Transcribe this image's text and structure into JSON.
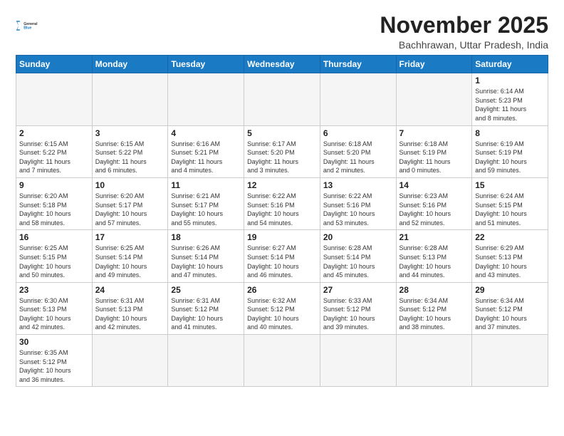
{
  "header": {
    "logo_text_normal": "General",
    "logo_text_blue": "Blue",
    "month_title": "November 2025",
    "location": "Bachhrawan, Uttar Pradesh, India"
  },
  "weekdays": [
    "Sunday",
    "Monday",
    "Tuesday",
    "Wednesday",
    "Thursday",
    "Friday",
    "Saturday"
  ],
  "days": [
    {
      "num": "",
      "info": "",
      "empty": true
    },
    {
      "num": "",
      "info": "",
      "empty": true
    },
    {
      "num": "",
      "info": "",
      "empty": true
    },
    {
      "num": "",
      "info": "",
      "empty": true
    },
    {
      "num": "",
      "info": "",
      "empty": true
    },
    {
      "num": "",
      "info": "",
      "empty": true
    },
    {
      "num": "1",
      "info": "Sunrise: 6:14 AM\nSunset: 5:23 PM\nDaylight: 11 hours\nand 8 minutes.",
      "empty": false
    },
    {
      "num": "2",
      "info": "Sunrise: 6:15 AM\nSunset: 5:22 PM\nDaylight: 11 hours\nand 7 minutes.",
      "empty": false
    },
    {
      "num": "3",
      "info": "Sunrise: 6:15 AM\nSunset: 5:22 PM\nDaylight: 11 hours\nand 6 minutes.",
      "empty": false
    },
    {
      "num": "4",
      "info": "Sunrise: 6:16 AM\nSunset: 5:21 PM\nDaylight: 11 hours\nand 4 minutes.",
      "empty": false
    },
    {
      "num": "5",
      "info": "Sunrise: 6:17 AM\nSunset: 5:20 PM\nDaylight: 11 hours\nand 3 minutes.",
      "empty": false
    },
    {
      "num": "6",
      "info": "Sunrise: 6:18 AM\nSunset: 5:20 PM\nDaylight: 11 hours\nand 2 minutes.",
      "empty": false
    },
    {
      "num": "7",
      "info": "Sunrise: 6:18 AM\nSunset: 5:19 PM\nDaylight: 11 hours\nand 0 minutes.",
      "empty": false
    },
    {
      "num": "8",
      "info": "Sunrise: 6:19 AM\nSunset: 5:19 PM\nDaylight: 10 hours\nand 59 minutes.",
      "empty": false
    },
    {
      "num": "9",
      "info": "Sunrise: 6:20 AM\nSunset: 5:18 PM\nDaylight: 10 hours\nand 58 minutes.",
      "empty": false
    },
    {
      "num": "10",
      "info": "Sunrise: 6:20 AM\nSunset: 5:17 PM\nDaylight: 10 hours\nand 57 minutes.",
      "empty": false
    },
    {
      "num": "11",
      "info": "Sunrise: 6:21 AM\nSunset: 5:17 PM\nDaylight: 10 hours\nand 55 minutes.",
      "empty": false
    },
    {
      "num": "12",
      "info": "Sunrise: 6:22 AM\nSunset: 5:16 PM\nDaylight: 10 hours\nand 54 minutes.",
      "empty": false
    },
    {
      "num": "13",
      "info": "Sunrise: 6:22 AM\nSunset: 5:16 PM\nDaylight: 10 hours\nand 53 minutes.",
      "empty": false
    },
    {
      "num": "14",
      "info": "Sunrise: 6:23 AM\nSunset: 5:16 PM\nDaylight: 10 hours\nand 52 minutes.",
      "empty": false
    },
    {
      "num": "15",
      "info": "Sunrise: 6:24 AM\nSunset: 5:15 PM\nDaylight: 10 hours\nand 51 minutes.",
      "empty": false
    },
    {
      "num": "16",
      "info": "Sunrise: 6:25 AM\nSunset: 5:15 PM\nDaylight: 10 hours\nand 50 minutes.",
      "empty": false
    },
    {
      "num": "17",
      "info": "Sunrise: 6:25 AM\nSunset: 5:14 PM\nDaylight: 10 hours\nand 49 minutes.",
      "empty": false
    },
    {
      "num": "18",
      "info": "Sunrise: 6:26 AM\nSunset: 5:14 PM\nDaylight: 10 hours\nand 47 minutes.",
      "empty": false
    },
    {
      "num": "19",
      "info": "Sunrise: 6:27 AM\nSunset: 5:14 PM\nDaylight: 10 hours\nand 46 minutes.",
      "empty": false
    },
    {
      "num": "20",
      "info": "Sunrise: 6:28 AM\nSunset: 5:14 PM\nDaylight: 10 hours\nand 45 minutes.",
      "empty": false
    },
    {
      "num": "21",
      "info": "Sunrise: 6:28 AM\nSunset: 5:13 PM\nDaylight: 10 hours\nand 44 minutes.",
      "empty": false
    },
    {
      "num": "22",
      "info": "Sunrise: 6:29 AM\nSunset: 5:13 PM\nDaylight: 10 hours\nand 43 minutes.",
      "empty": false
    },
    {
      "num": "23",
      "info": "Sunrise: 6:30 AM\nSunset: 5:13 PM\nDaylight: 10 hours\nand 42 minutes.",
      "empty": false
    },
    {
      "num": "24",
      "info": "Sunrise: 6:31 AM\nSunset: 5:13 PM\nDaylight: 10 hours\nand 42 minutes.",
      "empty": false
    },
    {
      "num": "25",
      "info": "Sunrise: 6:31 AM\nSunset: 5:12 PM\nDaylight: 10 hours\nand 41 minutes.",
      "empty": false
    },
    {
      "num": "26",
      "info": "Sunrise: 6:32 AM\nSunset: 5:12 PM\nDaylight: 10 hours\nand 40 minutes.",
      "empty": false
    },
    {
      "num": "27",
      "info": "Sunrise: 6:33 AM\nSunset: 5:12 PM\nDaylight: 10 hours\nand 39 minutes.",
      "empty": false
    },
    {
      "num": "28",
      "info": "Sunrise: 6:34 AM\nSunset: 5:12 PM\nDaylight: 10 hours\nand 38 minutes.",
      "empty": false
    },
    {
      "num": "29",
      "info": "Sunrise: 6:34 AM\nSunset: 5:12 PM\nDaylight: 10 hours\nand 37 minutes.",
      "empty": false
    },
    {
      "num": "30",
      "info": "Sunrise: 6:35 AM\nSunset: 5:12 PM\nDaylight: 10 hours\nand 36 minutes.",
      "empty": false
    },
    {
      "num": "",
      "info": "",
      "empty": true
    },
    {
      "num": "",
      "info": "",
      "empty": true
    },
    {
      "num": "",
      "info": "",
      "empty": true
    },
    {
      "num": "",
      "info": "",
      "empty": true
    },
    {
      "num": "",
      "info": "",
      "empty": true
    },
    {
      "num": "",
      "info": "",
      "empty": true
    }
  ]
}
